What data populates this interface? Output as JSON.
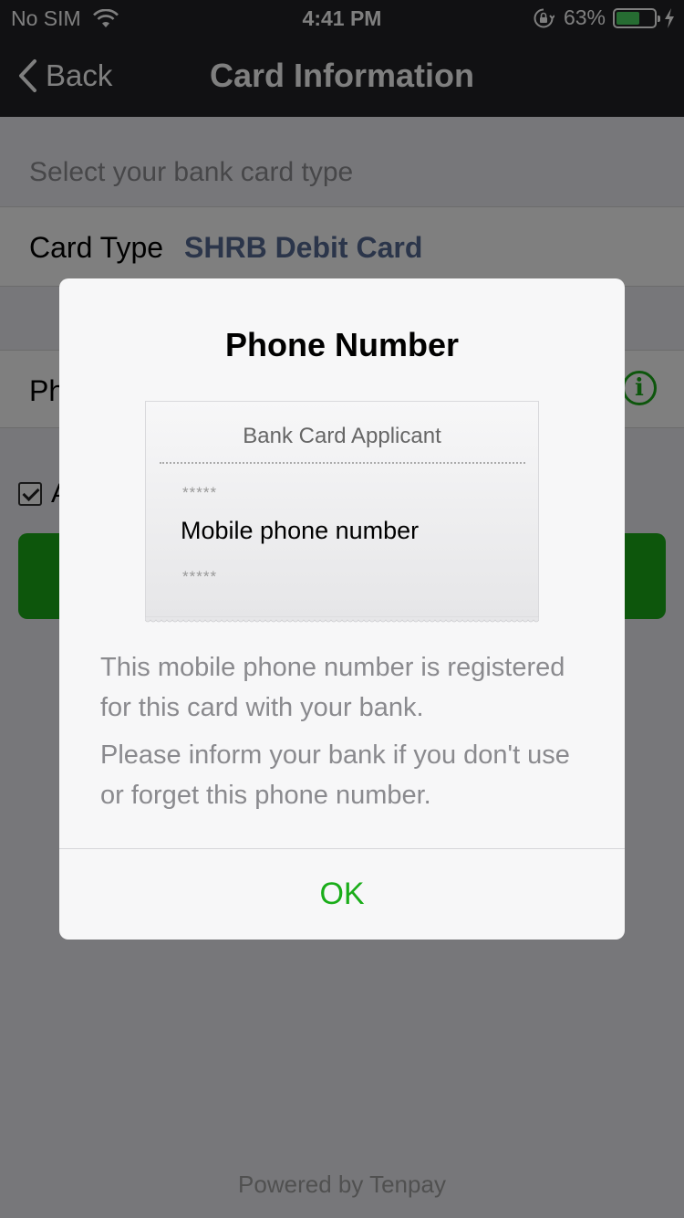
{
  "status_bar": {
    "carrier": "No SIM",
    "time": "4:41 PM",
    "battery_percent": "63%",
    "battery_level": 0.63
  },
  "nav": {
    "back_label": "Back",
    "title": "Card Information"
  },
  "form": {
    "section_hint": "Select your bank card type",
    "card_type_label": "Card Type",
    "card_type_value": "SHRB Debit Card",
    "phone_label": "Ph",
    "agree_label": "A"
  },
  "footer": {
    "powered_by": "Powered by Tenpay"
  },
  "dialog": {
    "title": "Phone Number",
    "receipt_header": "Bank Card Applicant",
    "mask_top": "*****",
    "receipt_phone": "Mobile phone number",
    "mask_bottom": "*****",
    "text1": "This mobile phone number is registered for this card with your bank.",
    "text2": "Please inform your bank if you don't use or forget this phone number.",
    "ok_label": "OK"
  },
  "colors": {
    "accent_green": "#1aad19",
    "link_blue": "#576b95",
    "nav_bg": "#222326"
  },
  "icons": [
    "wifi-icon",
    "orientation-lock-icon",
    "battery-icon",
    "charging-bolt-icon",
    "chevron-left-icon",
    "info-icon",
    "checkbox-icon"
  ]
}
